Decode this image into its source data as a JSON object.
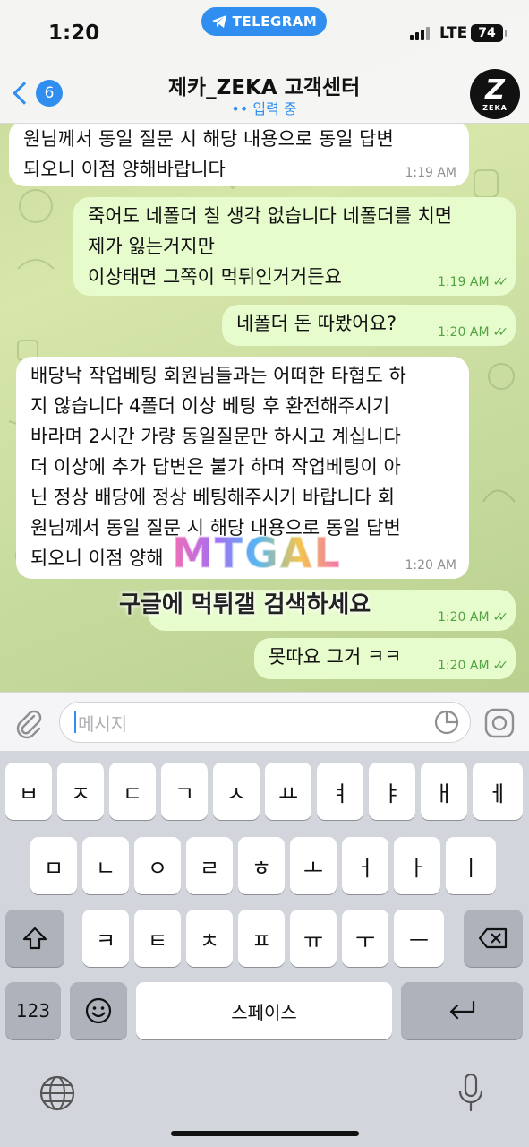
{
  "status_bar": {
    "time": "1:20",
    "app_pill": "TELEGRAM",
    "network": "LTE",
    "battery": "74"
  },
  "header": {
    "back_count": "6",
    "title": "제카_ZEKA 고객센터",
    "subtitle": "입력 중",
    "avatar_text": "Z",
    "avatar_caption": "ZEKA"
  },
  "messages": [
    {
      "side": "in",
      "text": "원님께서 동일 질문 시 해당 내용으로 동일 답변\n되오니 이점 양해바랍니다",
      "time": "1:19 AM"
    },
    {
      "side": "out",
      "text": "죽어도 네폴더 칠 생각 없습니다 네폴더를 치면\n제가 잃는거지만\n이상태면 그쪽이 먹튀인거거든요",
      "time": "1:19 AM"
    },
    {
      "side": "out",
      "text": "네폴더 돈 따봤어요?",
      "time": "1:20 AM"
    },
    {
      "side": "in",
      "text": "배당낙 작업베팅 회원님들과는 어떠한 타협도 하\n지 않습니다 4폴더 이상 베팅 후 환전해주시기\n바라며 2시간 가량 동일질문만 하시고 계십니다\n더 이상에 추가 답변은 불가 하며 작업베팅이 아\n닌 정상 배당에 정상 베팅해주시기 바랍니다 회\n원님께서 동일 질문 시 해당 내용으로 동일 답변\n되오니 이점 양해",
      "time": "1:20 AM"
    },
    {
      "side": "out",
      "text": "",
      "time": "1:20 AM"
    },
    {
      "side": "out",
      "text": "못따요 그거 ㅋㅋ",
      "time": "1:20 AM"
    }
  ],
  "watermark": {
    "logo": "MTGAL",
    "caption": "구글에 먹튀갤 검색하세요"
  },
  "input": {
    "placeholder": "메시지"
  },
  "keyboard": {
    "row1": [
      "ㅂ",
      "ㅈ",
      "ㄷ",
      "ㄱ",
      "ㅅ",
      "ㅛ",
      "ㅕ",
      "ㅑ",
      "ㅐ",
      "ㅔ"
    ],
    "row2": [
      "ㅁ",
      "ㄴ",
      "ㅇ",
      "ㄹ",
      "ㅎ",
      "ㅗ",
      "ㅓ",
      "ㅏ",
      "ㅣ"
    ],
    "row3": [
      "ㅋ",
      "ㅌ",
      "ㅊ",
      "ㅍ",
      "ㅠ",
      "ㅜ",
      "ㅡ"
    ],
    "numbers_key": "123",
    "space_key": "스페이스"
  }
}
